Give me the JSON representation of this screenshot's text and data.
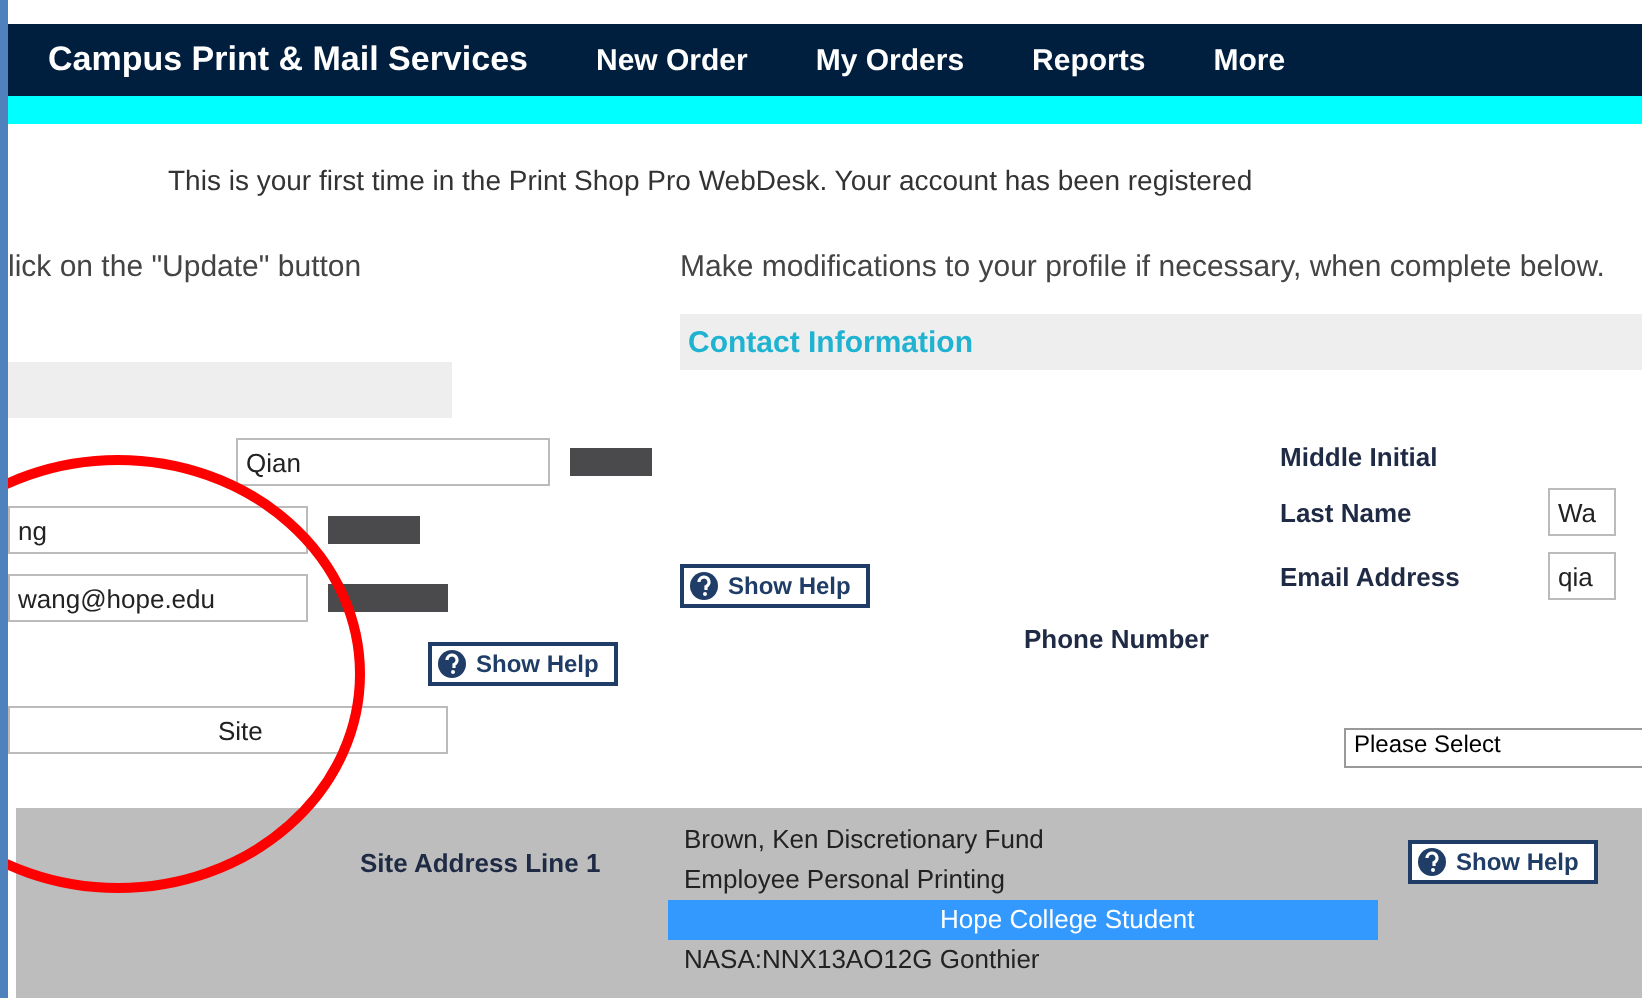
{
  "nav": {
    "brand": "Campus Print & Mail Services",
    "links": [
      "New Order",
      "My Orders",
      "Reports",
      "More"
    ]
  },
  "banner": "This is your first time in the Print Shop Pro WebDesk. Your account has been registered",
  "left": {
    "instruction": "lick on the \"Update\" button",
    "fields": [
      {
        "value": "Qian"
      },
      {
        "value": "ng"
      },
      {
        "value": "wang@hope.edu"
      }
    ],
    "site_label": "Site"
  },
  "right": {
    "instruction": "Make modifications to your profile if necessary, when complete below.",
    "section": "Contact Information",
    "rows": [
      {
        "label": "Middle Initial",
        "value": ""
      },
      {
        "label": "Last Name",
        "value": "Wa"
      },
      {
        "label": "Email Address",
        "value": "qia"
      }
    ],
    "phone_label": "Phone Number",
    "select_placeholder": "Please Select"
  },
  "help_buttons": [
    "Show Help",
    "Show Help",
    "Show Help"
  ],
  "site_address_label": "Site Address Line 1",
  "dropdown": [
    {
      "label": "Brown, Ken Discretionary Fund",
      "selected": false
    },
    {
      "label": "Employee Personal Printing",
      "selected": false
    },
    {
      "label": "Hope College Student",
      "selected": true
    },
    {
      "label": "NASA:NNX13AO12G Gonthier",
      "selected": false
    }
  ]
}
